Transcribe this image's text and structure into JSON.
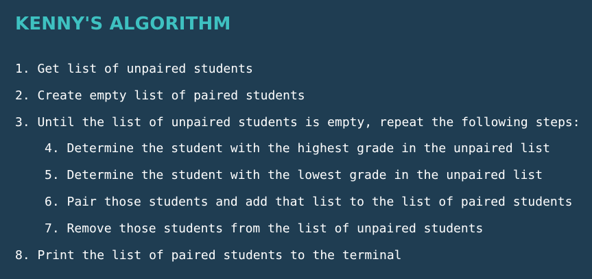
{
  "slide": {
    "title": "KENNY'S ALGORITHM",
    "steps": [
      {
        "text": "1. Get list of unpaired students",
        "indent": 0
      },
      {
        "text": "2. Create empty list of paired students",
        "indent": 0
      },
      {
        "text": "3. Until the list of unpaired students is empty, repeat the following steps:",
        "indent": 0
      },
      {
        "text": "4. Determine the student with the highest grade in the unpaired list",
        "indent": 1
      },
      {
        "text": "5. Determine the student with the lowest grade in the unpaired list",
        "indent": 1
      },
      {
        "text": "6. Pair those students and add that list to the list of paired students",
        "indent": 1
      },
      {
        "text": "7. Remove those students from the list of unpaired students",
        "indent": 1
      },
      {
        "text": "8. Print the list of paired students to the terminal",
        "indent": 0
      }
    ]
  },
  "colors": {
    "background": "#1f3d52",
    "title": "#3ec1c1",
    "text": "#ffffff"
  }
}
